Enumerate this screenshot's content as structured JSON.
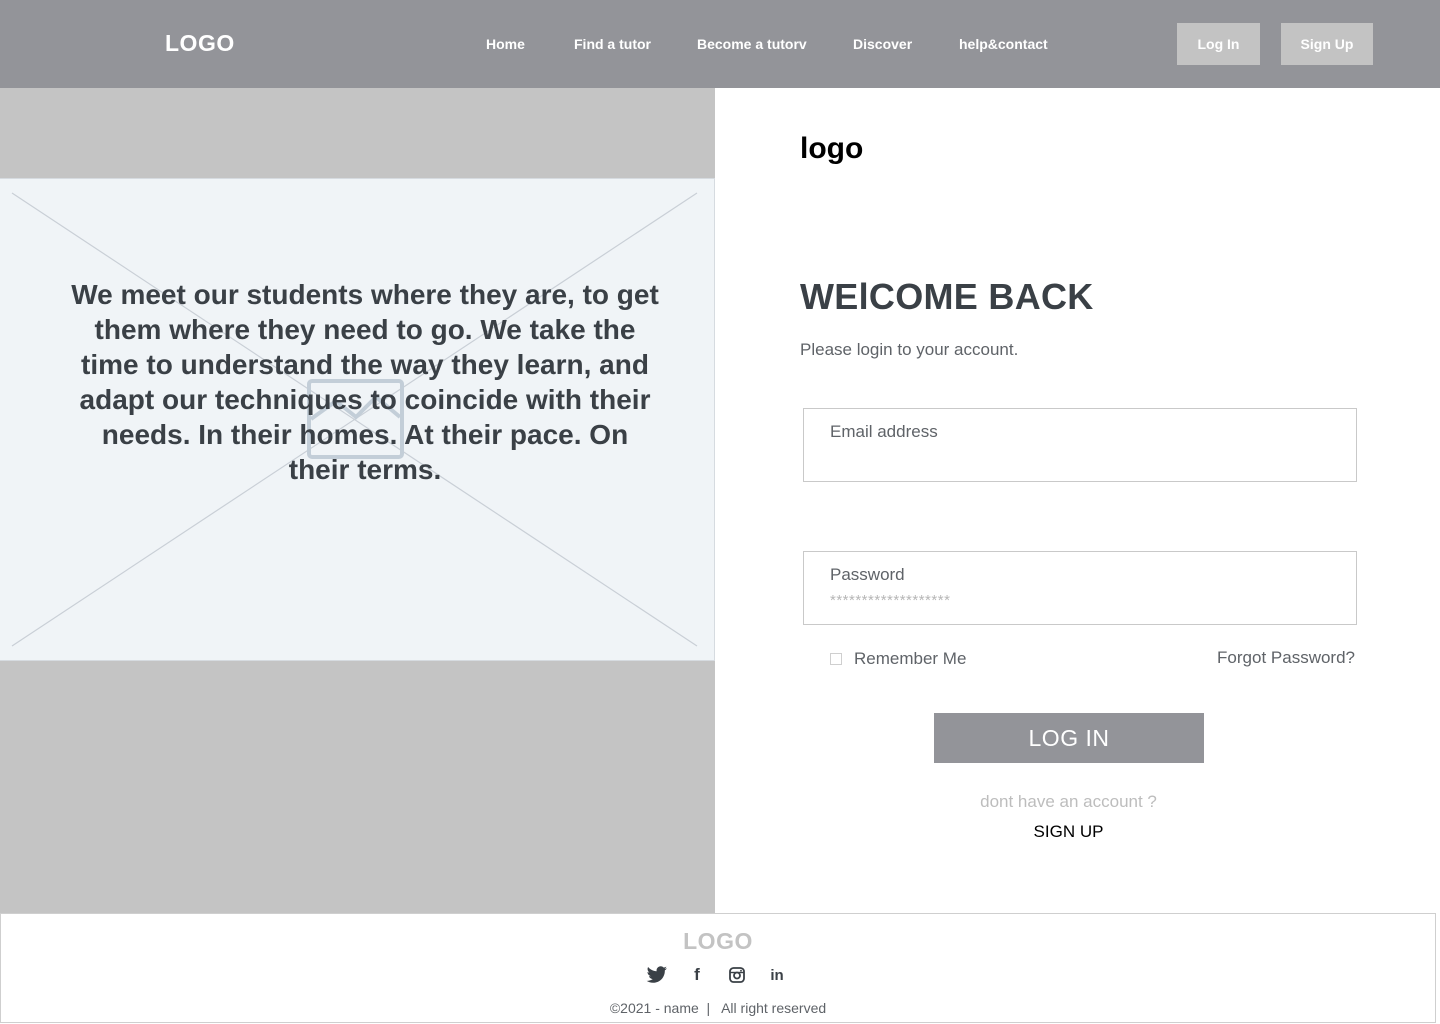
{
  "header": {
    "brand": "LOGO",
    "nav": [
      {
        "label": "Home"
      },
      {
        "label": "Find a tutor"
      },
      {
        "label": "Become a tutorv"
      },
      {
        "label": "Discover"
      },
      {
        "label": "help&contact"
      }
    ],
    "login_label": "Log In",
    "signup_label": "Sign Up"
  },
  "hero": {
    "text": "We meet our students where they are, to get them where they need to go. We take the time to understand the way they learn, and adapt our techniques to coincide with their needs. In their homes. At their pace. On their terms."
  },
  "login": {
    "logo": "logo",
    "title": "WElCOME BACK",
    "subtitle": "Please login to your account.",
    "email_label": "Email address",
    "email_value": "",
    "password_label": "Password",
    "password_value": "*******************",
    "remember_label": "Remember Me",
    "remember_checked": false,
    "forgot_label": "Forgot Password?",
    "submit_label": "LOG IN",
    "no_account_text": "dont have an account ?",
    "signup_label": "SIGN UP"
  },
  "footer": {
    "logo": "LOGO",
    "socials": [
      "twitter-icon",
      "facebook-icon",
      "instagram-icon",
      "linkedin-icon"
    ],
    "copyright": "©2021 - name  |   All right reserved"
  },
  "colors": {
    "header_bg": "#939499",
    "button_bg": "#c3c3c3",
    "hero_bg": "#c4c4c4",
    "placeholder_bg": "#f0f4f7",
    "heading": "#3a4046"
  }
}
